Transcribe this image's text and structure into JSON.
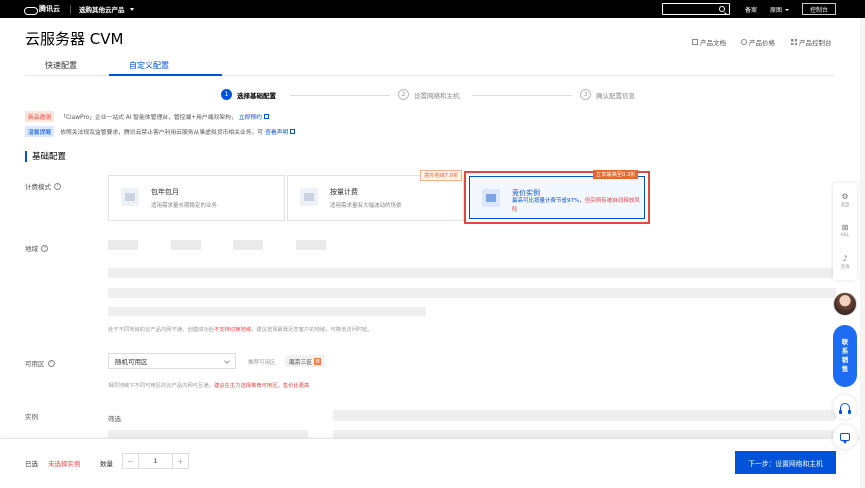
{
  "topbar": {
    "logo_text": "腾讯云",
    "product_menu": "选购其他云产品",
    "links": [
      "备案",
      "原图",
      "控制台"
    ]
  },
  "header": {
    "title": "云服务器 CVM",
    "links": [
      "产品文档",
      "产品价格",
      "产品控制台"
    ]
  },
  "tabs": [
    {
      "label": "快速配置",
      "active": false
    },
    {
      "label": "自定义配置",
      "active": true
    }
  ],
  "steps": [
    {
      "num": "1",
      "label": "选择基础配置",
      "active": true
    },
    {
      "num": "2",
      "label": "设置网络和主机",
      "active": false
    },
    {
      "num": "3",
      "label": "确认配置信息",
      "active": false
    }
  ],
  "notices": [
    {
      "tag": "新品邀测",
      "text": "「ClawPro」企业一站式 AI 智能体管理台，管控端+用户端双架构，",
      "link": "立即预约"
    },
    {
      "tag": "温馨提醒",
      "text": "依照关法规及监管要求，腾讯云禁止客户利用云服务从事虚拟货币相关业务，可",
      "link": "查看声明"
    }
  ],
  "section_title": "基础配置",
  "billing": {
    "label": "计费模式",
    "badges": {
      "pay_per_use": "境外地域7.8折",
      "spot": "立享最高至0.3折"
    },
    "options": [
      {
        "title": "包年包月",
        "desc": "适用需求量长期稳定的业务"
      },
      {
        "title": "按量计费",
        "desc": "适用需求量有大幅波动的场景"
      },
      {
        "title": "竞价实例",
        "desc_blue": "最高可比按量计费节省97%，",
        "desc_red": "但实例有被自动释放风险"
      }
    ]
  },
  "region": {
    "label": "地域",
    "hint_prefix": "处于不同地域的云产品内网不通，创建成功后",
    "hint_red": "不支持切换地域",
    "hint_suffix": "，建议选择最靠近您客户的地域，可降低访问时延。"
  },
  "zone": {
    "label": "可用区",
    "select_value": "随机可用区",
    "rec_label": "推荐可用区",
    "chip": "南京三区",
    "chip_badge": "荐",
    "hint_prefix": "相同地域下不同可用区的云产品内网可互通，",
    "hint_red": "建议在主力选择推荐可用区，售价比更高"
  },
  "instance": {
    "label": "实例",
    "filter": "筛选"
  },
  "bottom": {
    "selected_label": "已选",
    "selected_value": "未选择实例",
    "qty_label": "数量",
    "qty_value": "1",
    "next_button": "下一步：设置网络和主机"
  },
  "float_tools": [
    "选型",
    "K8L",
    "咨询"
  ],
  "contact_chars": [
    "联",
    "系",
    "销",
    "售"
  ]
}
